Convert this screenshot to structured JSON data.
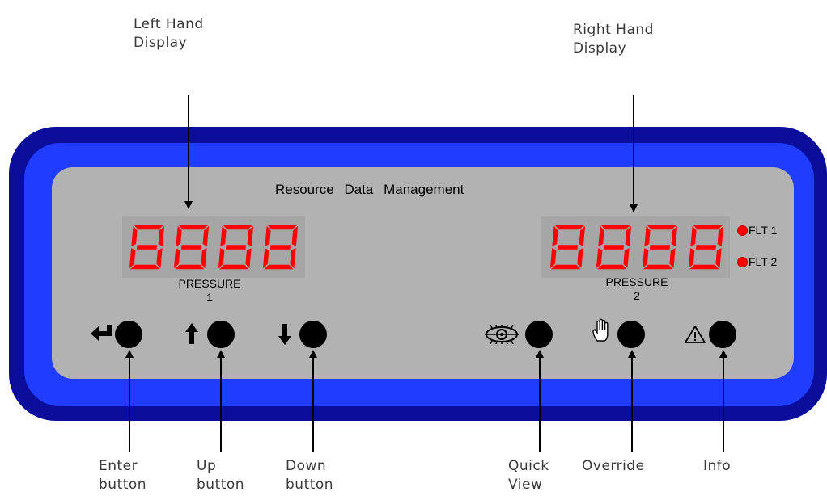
{
  "callouts": {
    "left_display": [
      "Left Hand",
      "Display"
    ],
    "right_display": [
      "Right Hand",
      "Display"
    ],
    "enter": [
      "Enter",
      "button"
    ],
    "up": [
      "Up",
      "button"
    ],
    "down": [
      "Down",
      "button"
    ],
    "quick_view": [
      "Quick",
      "View"
    ],
    "override": [
      "Override"
    ],
    "info": [
      "Info"
    ]
  },
  "panel": {
    "brand": "Resource Data Management",
    "left_display": {
      "label": "PRESSURE",
      "channel": "1",
      "digits": "8888"
    },
    "right_display": {
      "label": "PRESSURE",
      "channel": "2",
      "digits": "8888"
    },
    "leds": [
      {
        "label": "FLT 1",
        "color": "#ff0000"
      },
      {
        "label": "FLT 2",
        "color": "#ff0000"
      }
    ],
    "buttons": [
      {
        "name": "enter",
        "icon": "enter-arrow-icon"
      },
      {
        "name": "up",
        "icon": "up-arrow-icon"
      },
      {
        "name": "down",
        "icon": "down-arrow-icon"
      },
      {
        "name": "quick-view",
        "icon": "eye-icon"
      },
      {
        "name": "override",
        "icon": "hand-icon"
      },
      {
        "name": "info",
        "icon": "warning-triangle-icon"
      }
    ]
  },
  "colors": {
    "bezel_outer": "#0a0e9a",
    "bezel_inner": "#1f3cff",
    "faceplate": "#b2b2b2",
    "display_bg": "#a6a6a6",
    "segment": "#ff0000"
  }
}
